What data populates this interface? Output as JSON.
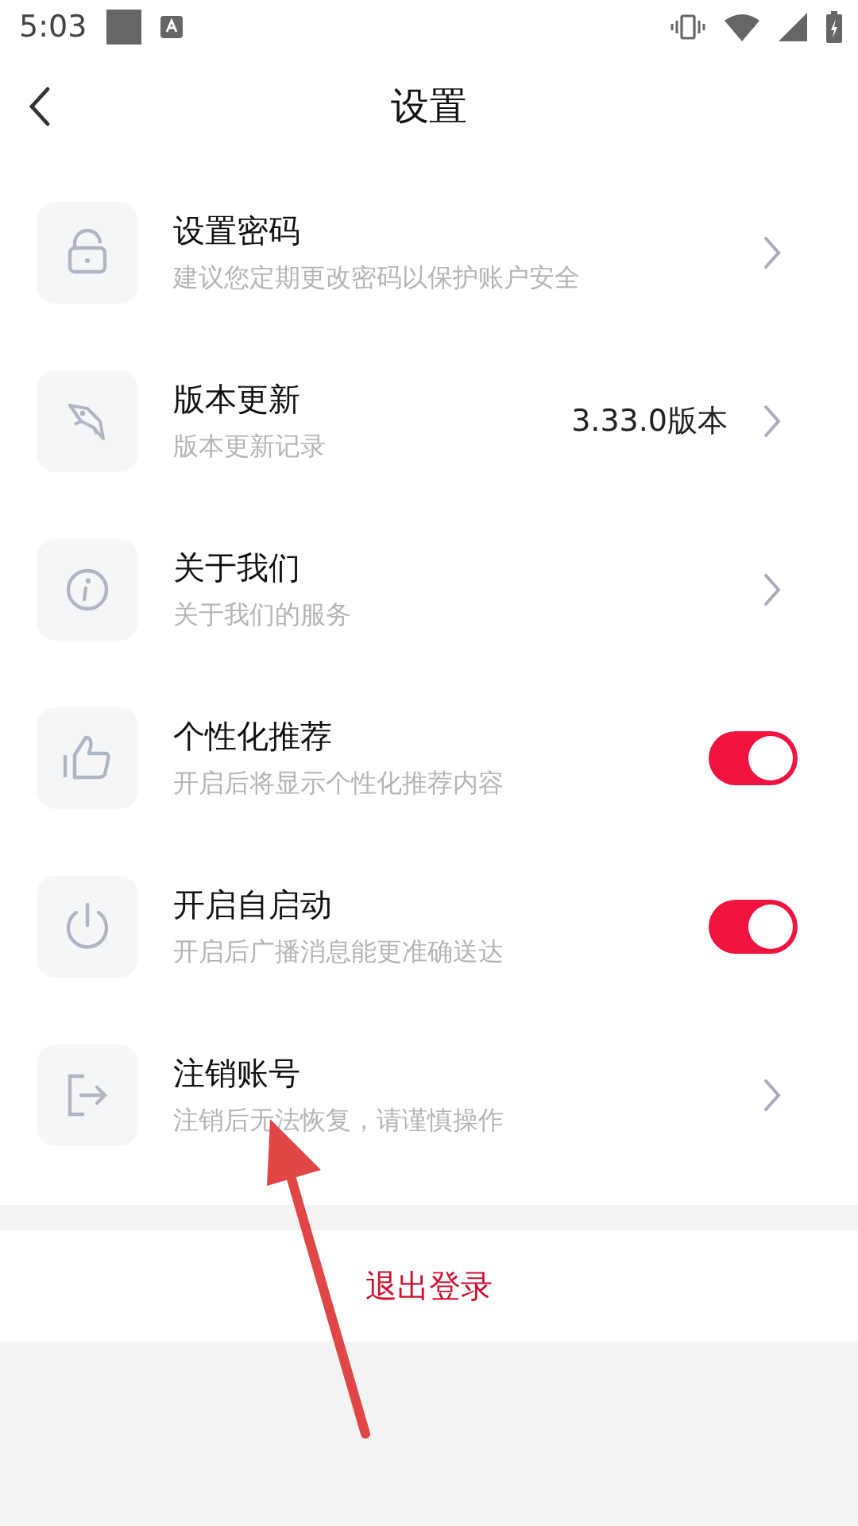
{
  "status_bar": {
    "time": "5:03"
  },
  "header": {
    "title": "设置"
  },
  "items": [
    {
      "kind": "link",
      "title": "设置密码",
      "subtitle": "建议您定期更改密码以保护账户安全"
    },
    {
      "kind": "link",
      "title": "版本更新",
      "subtitle": "版本更新记录",
      "value": "3.33.0版本"
    },
    {
      "kind": "link",
      "title": "关于我们",
      "subtitle": "关于我们的服务"
    },
    {
      "kind": "toggle",
      "title": "个性化推荐",
      "subtitle": "开启后将显示个性化推荐内容",
      "on": true
    },
    {
      "kind": "toggle",
      "title": "开启自启动",
      "subtitle": "开启后广播消息能更准确送达",
      "on": true
    },
    {
      "kind": "link",
      "title": "注销账号",
      "subtitle": "注销后无法恢复，请谨慎操作"
    }
  ],
  "logout": {
    "label": "退出登录"
  }
}
